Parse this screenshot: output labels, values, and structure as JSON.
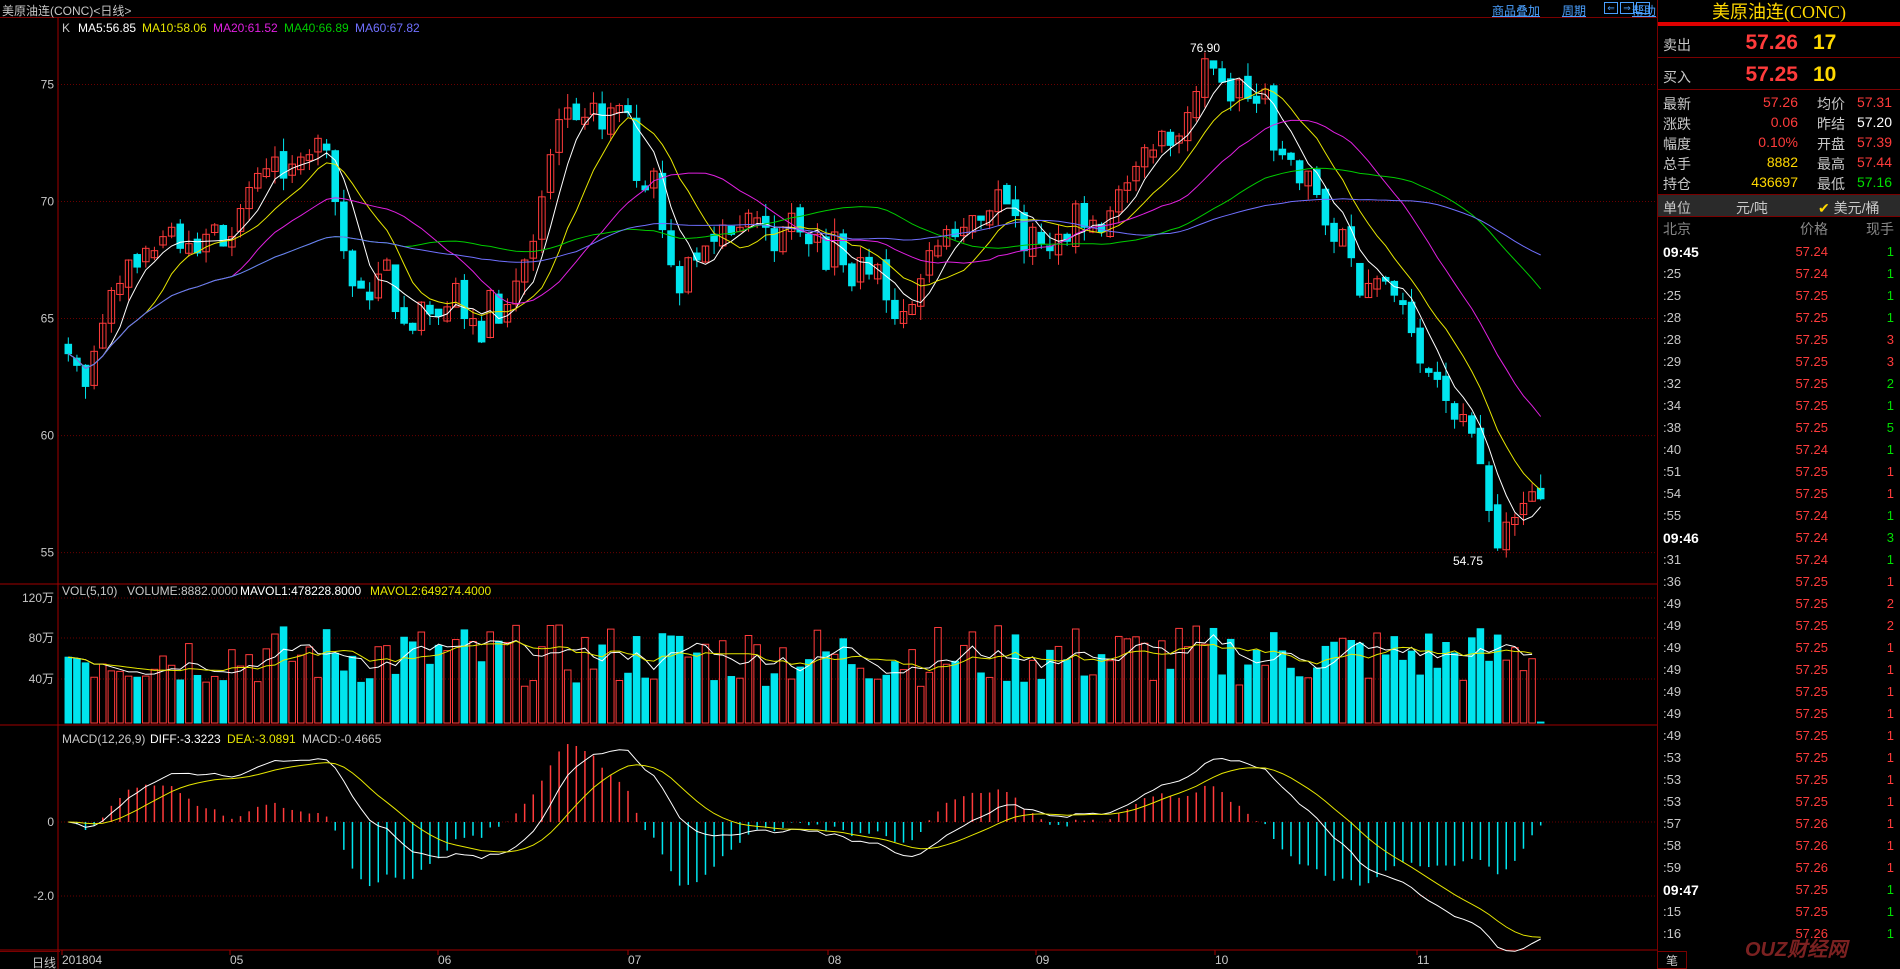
{
  "header": {
    "title": "美原油连(CONC)<日线>",
    "link_overlay": "商品叠加",
    "link_cycle": "周期",
    "link_help": "帮助"
  },
  "kline": {
    "label": "K",
    "ma5": "MA5:56.85",
    "ma10": "MA10:58.06",
    "ma20": "MA20:61.52",
    "ma40": "MA40:66.89",
    "ma60": "MA60:67.82",
    "y_ticks": [
      "75",
      "70",
      "65",
      "60",
      "55"
    ],
    "high_label": "76.90",
    "low_label": "54.75"
  },
  "volume": {
    "label": "VOL(5,10)",
    "volume": "VOLUME:8882.0000",
    "mavol1": "MAVOL1:478228.8000",
    "mavol2": "MAVOL2:649274.4000",
    "y_ticks": [
      "120万",
      "80万",
      "40万"
    ]
  },
  "macd": {
    "label": "MACD(12,26,9)",
    "diff": "DIFF:-3.3223",
    "dea": "DEA:-3.0891",
    "macd": "MACD:-0.4665",
    "y_ticks": [
      "0",
      "-2.0"
    ]
  },
  "x_axis": {
    "mode": "日线",
    "labels": [
      "201804",
      "05",
      "06",
      "07",
      "08",
      "09",
      "10",
      "11"
    ]
  },
  "chart_data": {
    "type": "candlestick",
    "title": "美原油连(CONC)<日线>",
    "ylim": [
      54,
      77.5
    ],
    "x_labels": [
      "201804",
      "05",
      "06",
      "07",
      "08",
      "09",
      "10",
      "11"
    ],
    "closes": [
      63.5,
      63.0,
      62.1,
      63.6,
      64.8,
      66.2,
      66.5,
      67.5,
      67.2,
      68.0,
      67.9,
      68.5,
      68.9,
      68.0,
      68.2,
      67.8,
      68.6,
      69.0,
      68.1,
      68.5,
      69.7,
      70.6,
      71.2,
      71.4,
      71.9,
      71.0,
      71.6,
      71.9,
      72.0,
      72.7,
      72.2,
      70.0,
      67.9,
      66.4,
      66.3,
      65.8,
      66.9,
      67.5,
      65.3,
      64.8,
      64.5,
      65.7,
      65.2,
      65.1,
      65.5,
      66.5,
      65.0,
      65.0,
      64.0,
      66.2,
      64.8,
      65.6,
      66.6,
      67.5,
      68.3,
      70.2,
      72.0,
      73.5,
      74.0,
      73.5,
      73.6,
      74.2,
      73.1,
      74.0,
      74.1,
      73.8,
      70.9,
      70.5,
      71.3,
      68.8,
      67.3,
      66.1,
      67.6,
      67.5,
      68.1,
      68.3,
      69.0,
      68.6,
      68.9,
      69.5,
      69.3,
      68.9,
      67.9,
      68.9,
      69.5,
      68.7,
      68.2,
      68.6,
      67.1,
      68.7,
      67.3,
      66.4,
      67.6,
      66.9,
      67.3,
      65.8,
      65.0,
      65.3,
      65.6,
      66.7,
      67.9,
      68.1,
      68.8,
      68.5,
      68.9,
      69.4,
      69.2,
      69.6,
      70.5,
      69.9,
      69.4,
      67.9,
      68.9,
      68.2,
      67.9,
      68.6,
      68.3,
      69.9,
      68.9,
      69.2,
      68.7,
      69.6,
      70.5,
      70.8,
      71.5,
      72.3,
      72.2,
      73.0,
      72.4,
      72.8,
      73.8,
      74.7,
      76.1,
      75.7,
      75.1,
      74.3,
      75.2,
      74.4,
      74.2,
      74.8,
      72.2,
      72.0,
      71.8,
      70.8,
      71.3,
      70.3,
      69.0,
      68.3,
      68.8,
      67.6,
      66.0,
      66.5,
      66.7,
      66.6,
      66.0,
      65.6,
      64.4,
      63.1,
      62.7,
      62.4,
      61.5,
      60.7,
      60.9,
      60.1,
      58.8,
      56.8,
      55.2,
      56.3,
      56.5,
      57.1,
      57.6,
      57.3
    ]
  },
  "panel": {
    "title": "美原油连(CONC)",
    "sell_label": "卖出",
    "sell_price": "57.26",
    "sell_vol": "17",
    "buy_label": "买入",
    "buy_price": "57.25",
    "buy_vol": "10",
    "stats": [
      {
        "a": "最新",
        "b": "57.26",
        "bc": "#ff3b3b",
        "c": "均价",
        "d": "57.31",
        "dc": "#ff3b3b"
      },
      {
        "a": "涨跌",
        "b": "0.06",
        "bc": "#ff3b3b",
        "c": "昨结",
        "d": "57.20",
        "dc": "#ffffff"
      },
      {
        "a": "幅度",
        "b": "0.10%",
        "bc": "#ff3b3b",
        "c": "开盘",
        "d": "57.39",
        "dc": "#ff3b3b"
      },
      {
        "a": "总手",
        "b": "8882",
        "bc": "#ffd800",
        "c": "最高",
        "d": "57.44",
        "dc": "#ff3b3b"
      },
      {
        "a": "持仓",
        "b": "436697",
        "bc": "#ffd800",
        "c": "最低",
        "d": "57.16",
        "dc": "#00e000"
      }
    ],
    "unit_label": "单位",
    "unit_cny": "元/吨",
    "unit_usd": "美元/桶",
    "col_time": "北京",
    "col_price": "价格",
    "col_vol": "现手",
    "ticks": [
      {
        "t": "09:45",
        "p": "57.24",
        "v": "1",
        "big": true
      },
      {
        "t": ":25",
        "p": "57.24",
        "v": "1"
      },
      {
        "t": ":25",
        "p": "57.25",
        "v": "1"
      },
      {
        "t": ":28",
        "p": "57.25",
        "v": "1"
      },
      {
        "t": ":28",
        "p": "57.25",
        "v": "3",
        "red": true
      },
      {
        "t": ":29",
        "p": "57.25",
        "v": "3",
        "red": true
      },
      {
        "t": ":32",
        "p": "57.25",
        "v": "2"
      },
      {
        "t": ":34",
        "p": "57.25",
        "v": "1"
      },
      {
        "t": ":38",
        "p": "57.25",
        "v": "5"
      },
      {
        "t": ":40",
        "p": "57.24",
        "v": "1"
      },
      {
        "t": ":51",
        "p": "57.25",
        "v": "1",
        "red": true
      },
      {
        "t": ":54",
        "p": "57.25",
        "v": "1",
        "red": true
      },
      {
        "t": ":55",
        "p": "57.24",
        "v": "1"
      },
      {
        "t": "09:46",
        "p": "57.24",
        "v": "3",
        "big": true
      },
      {
        "t": ":31",
        "p": "57.24",
        "v": "1"
      },
      {
        "t": ":36",
        "p": "57.25",
        "v": "1",
        "red": true
      },
      {
        "t": ":49",
        "p": "57.25",
        "v": "2",
        "red": true
      },
      {
        "t": ":49",
        "p": "57.25",
        "v": "2",
        "red": true
      },
      {
        "t": ":49",
        "p": "57.25",
        "v": "1",
        "red": true
      },
      {
        "t": ":49",
        "p": "57.25",
        "v": "1",
        "red": true
      },
      {
        "t": ":49",
        "p": "57.25",
        "v": "1",
        "red": true
      },
      {
        "t": ":49",
        "p": "57.25",
        "v": "1",
        "red": true
      },
      {
        "t": ":49",
        "p": "57.25",
        "v": "1",
        "red": true
      },
      {
        "t": ":53",
        "p": "57.25",
        "v": "1",
        "red": true
      },
      {
        "t": ":53",
        "p": "57.25",
        "v": "1",
        "red": true
      },
      {
        "t": ":53",
        "p": "57.25",
        "v": "1",
        "red": true
      },
      {
        "t": ":57",
        "p": "57.26",
        "v": "1",
        "red": true
      },
      {
        "t": ":58",
        "p": "57.26",
        "v": "1",
        "red": true
      },
      {
        "t": ":59",
        "p": "57.26",
        "v": "1",
        "red": true
      },
      {
        "t": "09:47",
        "p": "57.25",
        "v": "1",
        "big": true
      },
      {
        "t": ":15",
        "p": "57.25",
        "v": "1"
      },
      {
        "t": ":16",
        "p": "57.26",
        "v": "1"
      }
    ],
    "footer": "笔"
  },
  "colors": {
    "up": "#ff3b3b",
    "down": "#00e5ee",
    "ma5": "#ffffff",
    "ma10": "#e6e600",
    "ma20": "#e020e0",
    "ma40": "#00cc00",
    "ma60": "#7070ff",
    "grid": "#6a0000"
  },
  "watermark": "OUZ财经网"
}
